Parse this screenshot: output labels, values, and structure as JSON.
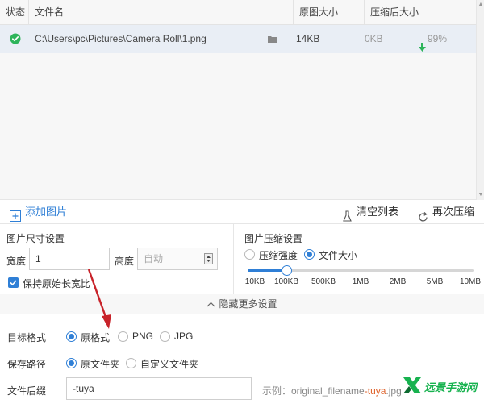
{
  "table": {
    "headers": {
      "status": "状态",
      "filename": "文件名",
      "original_size": "原图大小",
      "compressed_size": "压缩后大小"
    },
    "rows": [
      {
        "status_icon": "check-circle-icon",
        "path": "C:\\Users\\pc\\Pictures\\Camera Roll\\1.png",
        "folder_icon": "folder-icon",
        "original_size": "14KB",
        "compressed_size": "0KB",
        "ratio": "99%"
      }
    ]
  },
  "toolbar": {
    "add_image": "添加图片",
    "clear_list": "清空列表",
    "recompress": "再次压缩"
  },
  "size_settings": {
    "title": "图片尺寸设置",
    "width_label": "宽度",
    "width_value": "1",
    "height_label": "高度",
    "height_placeholder": "自动",
    "keep_ratio_label": "保持原始长宽比",
    "keep_ratio_checked": true
  },
  "compress_settings": {
    "title": "图片压缩设置",
    "mode_strength": "压缩强度",
    "mode_filesize": "文件大小",
    "selected_mode": "文件大小",
    "ticks": [
      "10KB",
      "100KB",
      "500KB",
      "1MB",
      "2MB",
      "5MB",
      "10MB"
    ],
    "selected_tick": "100KB"
  },
  "collapse": {
    "label": "隐藏更多设置"
  },
  "more_settings": {
    "target_format_label": "目标格式",
    "formats": [
      "原格式",
      "PNG",
      "JPG"
    ],
    "selected_format": "原格式",
    "save_path_label": "保存路径",
    "paths": [
      "原文件夹",
      "自定义文件夹"
    ],
    "selected_path": "原文件夹",
    "suffix_label": "文件后缀",
    "suffix_value": "-tuya",
    "example_prefix": "示例：original_filename",
    "example_tag": "-tuya",
    "example_ext": ".jpg"
  },
  "watermark": {
    "text": "远景手游网"
  },
  "colors": {
    "accent": "#2f7fd6",
    "success": "#2db45a",
    "annotation_arrow": "#c8232a",
    "suffix_highlight": "#e0622a"
  }
}
